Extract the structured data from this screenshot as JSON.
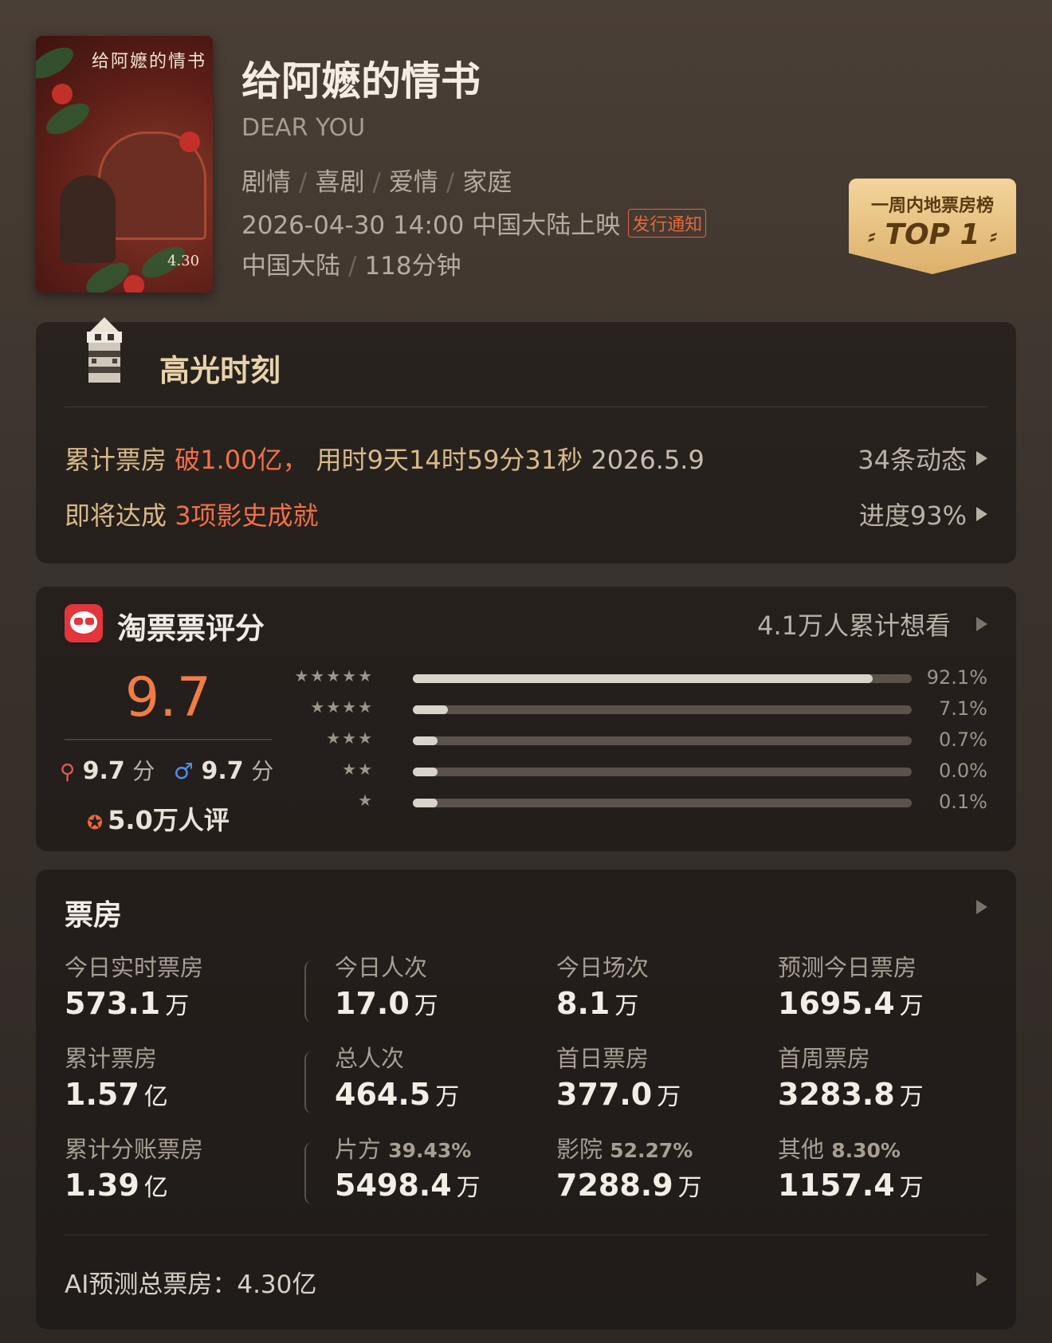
{
  "movie": {
    "poster_title": "给阿嬷的情书",
    "poster_date": "4.30",
    "title": "给阿嬷的情书",
    "english_title": "DEAR YOU",
    "genres": [
      "剧情",
      "喜剧",
      "爱情",
      "家庭"
    ],
    "release": "2026-04-30 14:00 中国大陆上映",
    "release_notice": "发行通知",
    "region": "中国大陆",
    "duration": "118分钟"
  },
  "rank_badge": {
    "line1": "一周内地票房榜",
    "line2": "TOP 1"
  },
  "highlights": {
    "title": "高光时刻",
    "row1": {
      "prefix": "累计票房 ",
      "hot": "破1.00亿，",
      "mid": " 用时9天14时59分31秒 ",
      "date": "2026.5.9",
      "right": "34条动态"
    },
    "row2": {
      "prefix": "即将达成 ",
      "hot": "3项影史成就",
      "right": "进度93%"
    }
  },
  "rating": {
    "title": "淘票票评分",
    "want": "4.1万人累计想看",
    "score": "9.7",
    "female_score": "9.7",
    "male_score": "9.7",
    "score_unit": "分",
    "raters": "5.0万人评",
    "distribution": [
      {
        "stars": "★★★★★",
        "pct_label": "92.1%",
        "value": 0.921
      },
      {
        "stars": "★★★★",
        "pct_label": "7.1%",
        "value": 0.071
      },
      {
        "stars": "★★★",
        "pct_label": "0.7%",
        "value": 0.007
      },
      {
        "stars": "★★",
        "pct_label": "0.0%",
        "value": 0.0
      },
      {
        "stars": "★",
        "pct_label": "0.1%",
        "value": 0.001
      }
    ]
  },
  "box_office": {
    "title": "票房",
    "row1": [
      {
        "label": "今日实时票房",
        "value": "573.1",
        "unit": "万"
      },
      {
        "label": "今日人次",
        "value": "17.0",
        "unit": "万"
      },
      {
        "label": "今日场次",
        "value": "8.1",
        "unit": "万"
      },
      {
        "label": "预测今日票房",
        "value": "1695.4",
        "unit": "万"
      }
    ],
    "row2": [
      {
        "label": "累计票房",
        "value": "1.57",
        "unit": "亿"
      },
      {
        "label": "总人次",
        "value": "464.5",
        "unit": "万"
      },
      {
        "label": "首日票房",
        "value": "377.0",
        "unit": "万"
      },
      {
        "label": "首周票房",
        "value": "3283.8",
        "unit": "万"
      }
    ],
    "row3": [
      {
        "label": "累计分账票房",
        "pct": "",
        "value": "1.39",
        "unit": "亿"
      },
      {
        "label": "片方",
        "pct": "39.43%",
        "value": "5498.4",
        "unit": "万"
      },
      {
        "label": "影院",
        "pct": "52.27%",
        "value": "7288.9",
        "unit": "万"
      },
      {
        "label": "其他",
        "pct": "8.30%",
        "value": "1157.4",
        "unit": "万"
      }
    ],
    "ai_prediction": "AI预测总票房：4.30亿"
  }
}
